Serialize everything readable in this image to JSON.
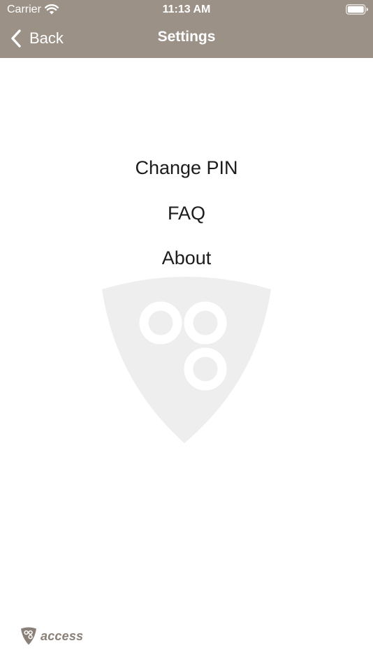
{
  "status_bar": {
    "carrier": "Carrier",
    "time": "11:13 AM",
    "icons": [
      "wifi-icon",
      "battery-icon"
    ]
  },
  "nav_bar": {
    "back_label": "Back",
    "title": "Settings",
    "back_icon": "chevron-left-icon"
  },
  "menu": {
    "items": [
      {
        "label": "Change PIN"
      },
      {
        "label": "FAQ"
      },
      {
        "label": "About"
      }
    ]
  },
  "footer": {
    "brand": "access",
    "logo_icon": "shield-logo-icon"
  },
  "colors": {
    "header_background": "#9b9187",
    "header_text": "#ffffff",
    "menu_text": "#1c1c1e",
    "watermark": "#eeeeee",
    "footer_brand": "#8a8078"
  }
}
